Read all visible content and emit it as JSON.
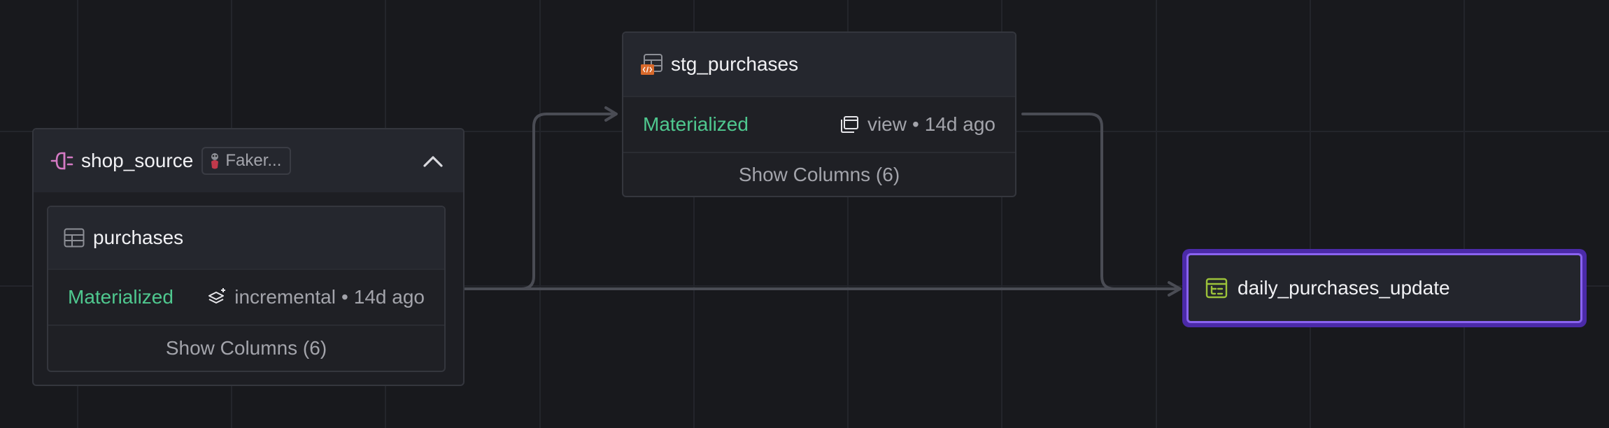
{
  "nodes": {
    "shop_source": {
      "title": "shop_source",
      "icon": "source-plug-icon",
      "badge": "Faker...",
      "badge_icon": "faker-logo-icon",
      "collapse_icon": "chevron-up-icon",
      "children": [
        {
          "title": "purchases",
          "icon": "table-icon",
          "status": "Materialized",
          "materialization": "incremental",
          "materialization_icon": "incremental-layers-icon",
          "separator": "•",
          "age": "14d ago",
          "show_columns": "Show Columns (6)"
        }
      ]
    },
    "stg_purchases": {
      "title": "stg_purchases",
      "icon": "sql-model-icon",
      "status": "Materialized",
      "materialization": "view",
      "materialization_icon": "view-windows-icon",
      "separator": "•",
      "age": "14d ago",
      "show_columns": "Show Columns (6)"
    },
    "daily_purchases_update": {
      "title": "daily_purchases_update",
      "icon": "job-icon",
      "selected": true
    }
  },
  "edges": [
    {
      "from": "purchases",
      "to": "stg_purchases"
    },
    {
      "from": "purchases",
      "to": "daily_purchases_update"
    },
    {
      "from": "stg_purchases",
      "to": "daily_purchases_update"
    }
  ],
  "colors": {
    "background": "#18191d",
    "materialized": "#4fc88f",
    "selection": "#8a63f0",
    "source_icon": "#d57ac4",
    "sql_badge": "#d9692b",
    "job_icon": "#9cc23a",
    "edge": "#4a4c54"
  }
}
